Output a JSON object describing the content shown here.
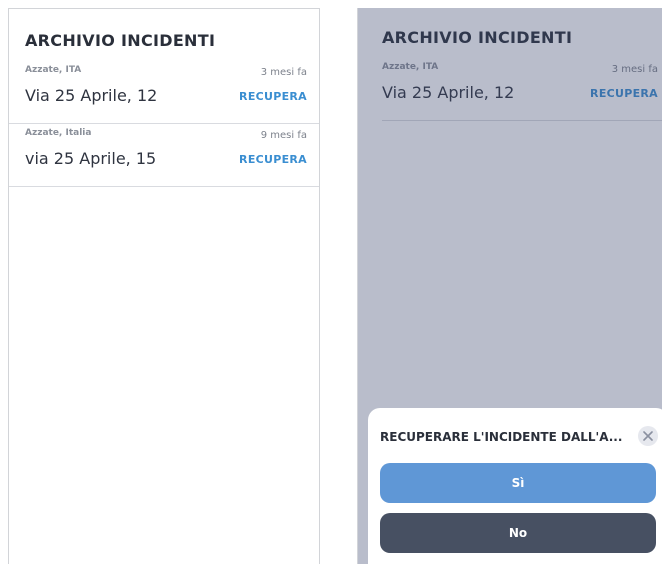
{
  "left": {
    "title": "ARCHIVIO INCIDENTI",
    "items": [
      {
        "city": "Azzate, ITA",
        "time": "3 mesi fa",
        "address": "Via 25 Aprile, 12",
        "action": "RECUPERA"
      },
      {
        "city": "Azzate, Italia",
        "time": "9 mesi fa",
        "address": "via 25 Aprile, 15",
        "action": "RECUPERA"
      }
    ]
  },
  "right": {
    "title": "ARCHIVIO INCIDENTI",
    "items": [
      {
        "city": "Azzate, ITA",
        "time": "3 mesi fa",
        "address": "Via 25 Aprile, 12",
        "action": "RECUPERA"
      }
    ],
    "dialog": {
      "title": "RECUPERARE L'INCIDENTE DALL'A...",
      "yes_label": "Sì",
      "no_label": "No",
      "close_icon": "close-icon"
    }
  },
  "colors": {
    "accent_link": "#3a8ed1",
    "yes_button": "#5f97d6",
    "no_button": "#475062",
    "overlay": "#b9bfd0"
  }
}
